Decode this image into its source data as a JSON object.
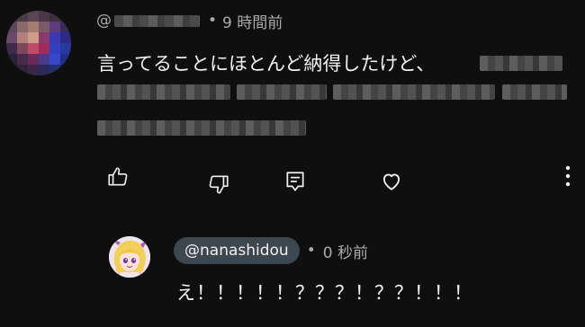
{
  "comment": {
    "author_prefix": "@",
    "separator": "•",
    "timestamp": "9 時間前",
    "text_visible": "言ってることにほとんど納得したけど、",
    "text_redacted": true,
    "actions": {
      "like": "thumbs-up-icon",
      "dislike": "thumbs-down-icon",
      "reply": "reply-icon",
      "heart": "heart-icon",
      "more": "more-vertical-icon"
    }
  },
  "reply": {
    "mention": "@nanashidou",
    "separator": "•",
    "timestamp": "0 秒前",
    "text": "え！！！！！？？？！？？！！！"
  },
  "colors": {
    "background": "#0f0f0f",
    "text_primary": "#f1f1f1",
    "text_secondary": "#aaaaaa",
    "mention_chip": "#3d4750"
  }
}
